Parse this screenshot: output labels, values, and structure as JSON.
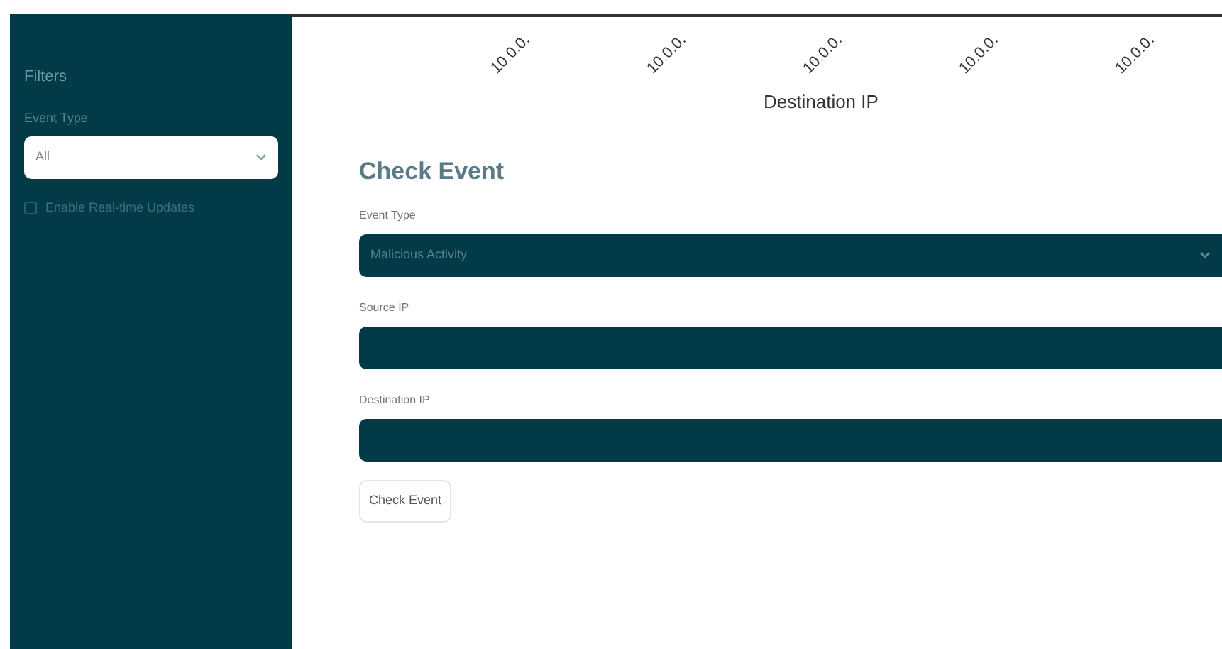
{
  "sidebar": {
    "title": "Filters",
    "event_type": {
      "label": "Event Type",
      "value": "All"
    },
    "realtime": {
      "label": "Enable Real-time Updates",
      "checked": false
    }
  },
  "chart": {
    "tick_labels": [
      "10.0.0.",
      "10.0.0.",
      "10.0.0.",
      "10.0.0.",
      "10.0.0."
    ],
    "xlabel": "Destination IP"
  },
  "check_event": {
    "title": "Check Event",
    "fields": [
      {
        "kind": "select",
        "label": "Event Type",
        "value": "Malicious Activity"
      },
      {
        "kind": "text",
        "label": "Source IP"
      },
      {
        "kind": "text",
        "label": "Destination IP"
      }
    ],
    "button": "Check Event"
  }
}
